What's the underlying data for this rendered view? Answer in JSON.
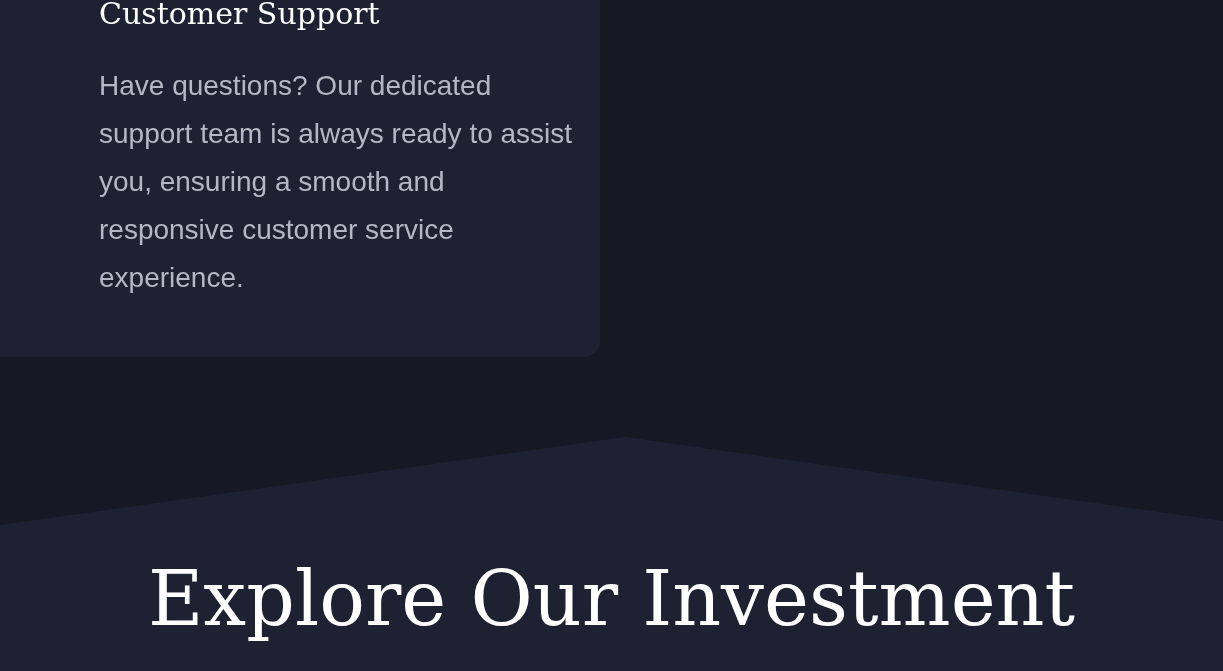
{
  "support_card": {
    "title": "Customer Support",
    "body": "Have questions? Our dedicated support team is always ready to assist you, ensuring a smooth and responsive customer service experience."
  },
  "next_section": {
    "heading": "Explore Our Investment"
  }
}
